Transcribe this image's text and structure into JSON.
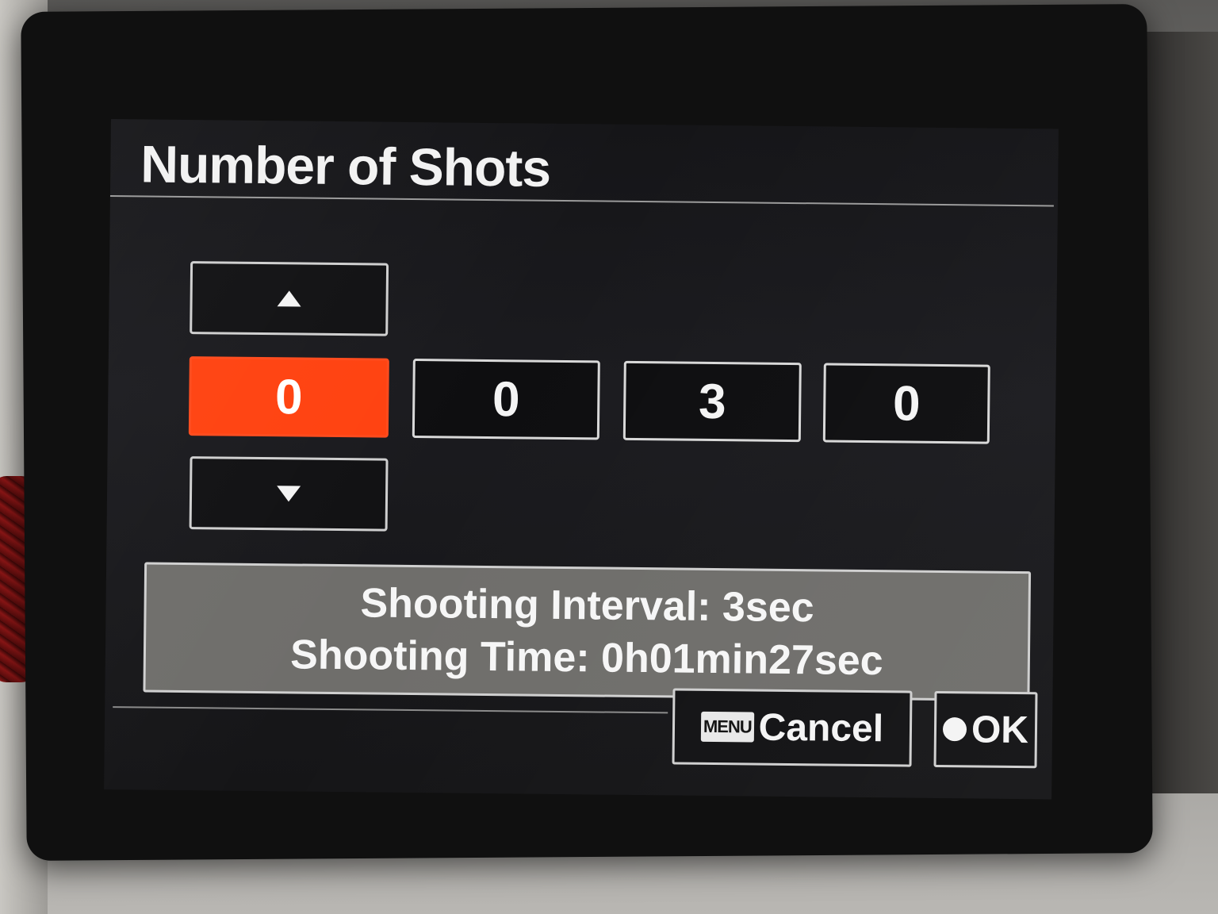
{
  "dialog": {
    "title": "Number of Shots"
  },
  "digits": [
    "0",
    "0",
    "3",
    "0"
  ],
  "selected_digit_index": 0,
  "controls": {
    "up_icon": "triangle-up",
    "down_icon": "triangle-down"
  },
  "info": {
    "interval": "Shooting Interval: 3sec",
    "time": "Shooting Time: 0h01min27sec"
  },
  "buttons": {
    "menu_key": "MENU",
    "cancel": "Cancel",
    "ok": "OK"
  },
  "colors": {
    "selected": "#ff4210",
    "screen_bg": "#18181b",
    "panel": "#6f6e6b",
    "text": "#f4f4f4"
  }
}
